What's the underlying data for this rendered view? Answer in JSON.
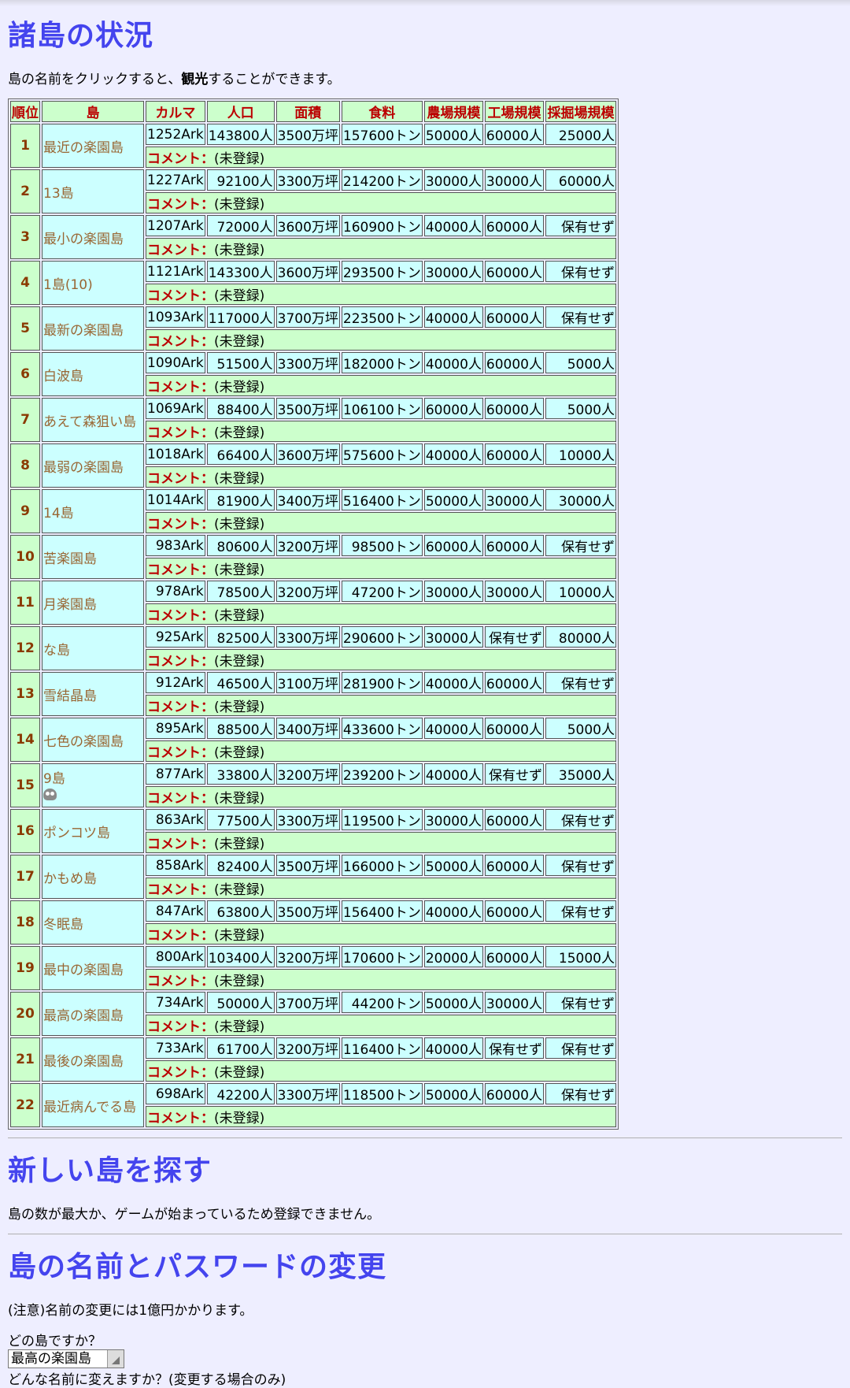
{
  "ranking": {
    "title": "諸島の状況",
    "desc_pre": "島の名前をクリックすると、",
    "desc_bold": "観光",
    "desc_post": "することができます。",
    "headers": [
      "順位",
      "島",
      "カルマ",
      "人口",
      "面積",
      "食料",
      "農場規模",
      "工場規模",
      "採掘場規模"
    ],
    "comment_label": "コメント：",
    "rows": [
      {
        "rank": "1",
        "name": "最近の楽園島",
        "karma": "1252Ark",
        "pop": "143800人",
        "area": "3500万坪",
        "food": "157600トン",
        "farm": "50000人",
        "factory": "60000人",
        "mine": "25000人",
        "comment": "(未登録)"
      },
      {
        "rank": "2",
        "name": "13島",
        "karma": "1227Ark",
        "pop": "92100人",
        "area": "3300万坪",
        "food": "214200トン",
        "farm": "30000人",
        "factory": "30000人",
        "mine": "60000人",
        "comment": "(未登録)"
      },
      {
        "rank": "3",
        "name": "最小の楽園島",
        "karma": "1207Ark",
        "pop": "72000人",
        "area": "3600万坪",
        "food": "160900トン",
        "farm": "40000人",
        "factory": "60000人",
        "mine": "保有せず",
        "comment": "(未登録)"
      },
      {
        "rank": "4",
        "name": "1島(10)",
        "karma": "1121Ark",
        "pop": "143300人",
        "area": "3600万坪",
        "food": "293500トン",
        "farm": "30000人",
        "factory": "60000人",
        "mine": "保有せず",
        "comment": "(未登録)"
      },
      {
        "rank": "5",
        "name": "最新の楽園島",
        "karma": "1093Ark",
        "pop": "117000人",
        "area": "3700万坪",
        "food": "223500トン",
        "farm": "40000人",
        "factory": "60000人",
        "mine": "保有せず",
        "comment": "(未登録)"
      },
      {
        "rank": "6",
        "name": "白波島",
        "karma": "1090Ark",
        "pop": "51500人",
        "area": "3300万坪",
        "food": "182000トン",
        "farm": "40000人",
        "factory": "60000人",
        "mine": "5000人",
        "comment": "(未登録)"
      },
      {
        "rank": "7",
        "name": "あえて森狙い島",
        "karma": "1069Ark",
        "pop": "88400人",
        "area": "3500万坪",
        "food": "106100トン",
        "farm": "60000人",
        "factory": "60000人",
        "mine": "5000人",
        "comment": "(未登録)"
      },
      {
        "rank": "8",
        "name": "最弱の楽園島",
        "karma": "1018Ark",
        "pop": "66400人",
        "area": "3600万坪",
        "food": "575600トン",
        "farm": "40000人",
        "factory": "60000人",
        "mine": "10000人",
        "comment": "(未登録)"
      },
      {
        "rank": "9",
        "name": "14島",
        "karma": "1014Ark",
        "pop": "81900人",
        "area": "3400万坪",
        "food": "516400トン",
        "farm": "50000人",
        "factory": "30000人",
        "mine": "30000人",
        "comment": "(未登録)"
      },
      {
        "rank": "10",
        "name": "苦楽園島",
        "karma": "983Ark",
        "pop": "80600人",
        "area": "3200万坪",
        "food": "98500トン",
        "farm": "60000人",
        "factory": "60000人",
        "mine": "保有せず",
        "comment": "(未登録)"
      },
      {
        "rank": "11",
        "name": "月楽園島",
        "karma": "978Ark",
        "pop": "78500人",
        "area": "3200万坪",
        "food": "47200トン",
        "farm": "30000人",
        "factory": "30000人",
        "mine": "10000人",
        "comment": "(未登録)"
      },
      {
        "rank": "12",
        "name": "な島",
        "karma": "925Ark",
        "pop": "82500人",
        "area": "3300万坪",
        "food": "290600トン",
        "farm": "30000人",
        "factory": "保有せず",
        "mine": "80000人",
        "comment": "(未登録)"
      },
      {
        "rank": "13",
        "name": "雪結晶島",
        "karma": "912Ark",
        "pop": "46500人",
        "area": "3100万坪",
        "food": "281900トン",
        "farm": "40000人",
        "factory": "60000人",
        "mine": "保有せず",
        "comment": "(未登録)"
      },
      {
        "rank": "14",
        "name": "七色の楽園島",
        "karma": "895Ark",
        "pop": "88500人",
        "area": "3400万坪",
        "food": "433600トン",
        "farm": "40000人",
        "factory": "60000人",
        "mine": "5000人",
        "comment": "(未登録)"
      },
      {
        "rank": "15",
        "name": "9島",
        "karma": "877Ark",
        "pop": "33800人",
        "area": "3200万坪",
        "food": "239200トン",
        "farm": "40000人",
        "factory": "保有せず",
        "mine": "35000人",
        "comment": "(未登録)",
        "monster": true
      },
      {
        "rank": "16",
        "name": "ポンコツ島",
        "karma": "863Ark",
        "pop": "77500人",
        "area": "3300万坪",
        "food": "119500トン",
        "farm": "30000人",
        "factory": "60000人",
        "mine": "保有せず",
        "comment": "(未登録)"
      },
      {
        "rank": "17",
        "name": "かもめ島",
        "karma": "858Ark",
        "pop": "82400人",
        "area": "3500万坪",
        "food": "166000トン",
        "farm": "50000人",
        "factory": "60000人",
        "mine": "保有せず",
        "comment": "(未登録)"
      },
      {
        "rank": "18",
        "name": "冬眠島",
        "karma": "847Ark",
        "pop": "63800人",
        "area": "3500万坪",
        "food": "156400トン",
        "farm": "40000人",
        "factory": "60000人",
        "mine": "保有せず",
        "comment": "(未登録)"
      },
      {
        "rank": "19",
        "name": "最中の楽園島",
        "karma": "800Ark",
        "pop": "103400人",
        "area": "3200万坪",
        "food": "170600トン",
        "farm": "20000人",
        "factory": "60000人",
        "mine": "15000人",
        "comment": "(未登録)"
      },
      {
        "rank": "20",
        "name": "最高の楽園島",
        "karma": "734Ark",
        "pop": "50000人",
        "area": "3700万坪",
        "food": "44200トン",
        "farm": "50000人",
        "factory": "30000人",
        "mine": "保有せず",
        "comment": "(未登録)"
      },
      {
        "rank": "21",
        "name": "最後の楽園島",
        "karma": "733Ark",
        "pop": "61700人",
        "area": "3200万坪",
        "food": "116400トン",
        "farm": "40000人",
        "factory": "保有せず",
        "mine": "保有せず",
        "comment": "(未登録)"
      },
      {
        "rank": "22",
        "name": "最近病んでる島",
        "karma": "698Ark",
        "pop": "42200人",
        "area": "3300万坪",
        "food": "118500トン",
        "farm": "50000人",
        "factory": "60000人",
        "mine": "保有せず",
        "comment": "(未登録)"
      }
    ]
  },
  "new_island": {
    "title": "新しい島を探す",
    "message": "島の数が最大か、ゲームが始まっているため登録できません。"
  },
  "rename": {
    "title": "島の名前とパスワードの変更",
    "notice": "(注意)名前の変更には1億円かかります。",
    "which_label": "どの島ですか？",
    "selected_island": "最高の楽園島",
    "new_name_label": "どんな名前に変えますか？(変更する場合のみ)"
  }
}
